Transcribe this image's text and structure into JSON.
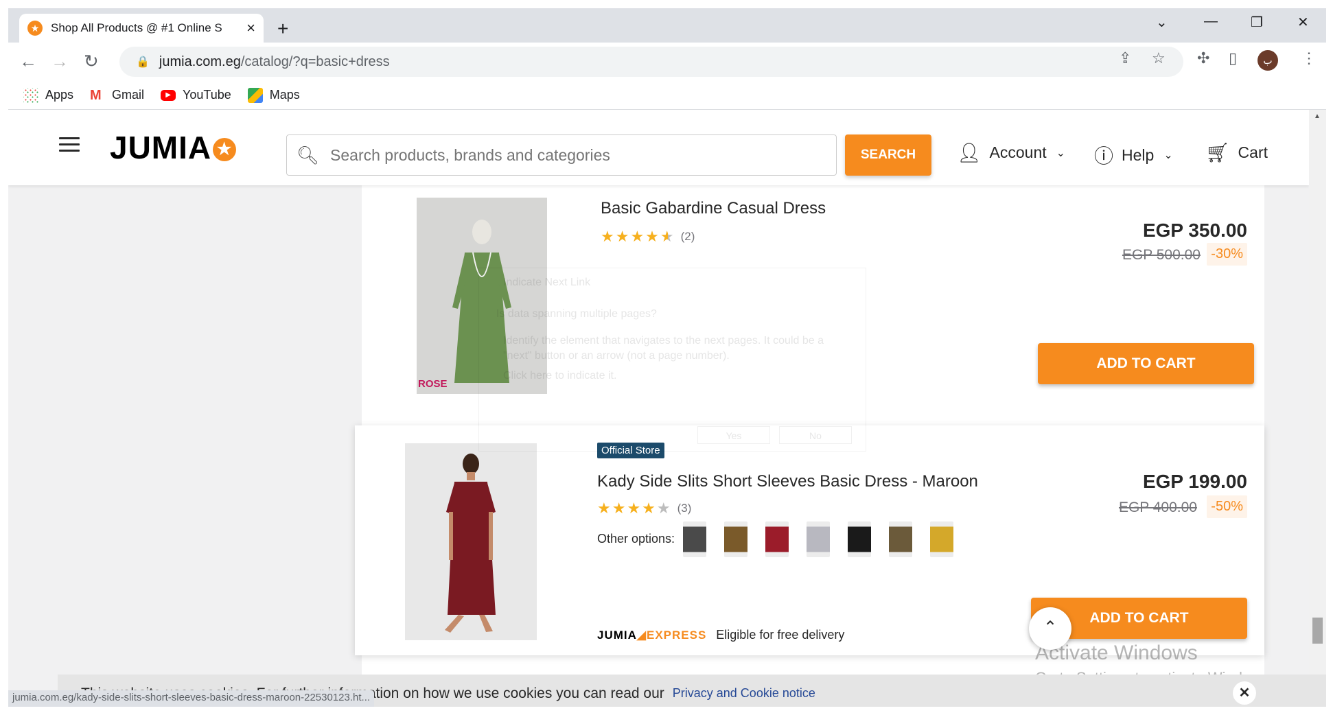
{
  "browser": {
    "tab_title": "Shop All Products @ #1 Online S",
    "url_host": "jumia.com.eg",
    "url_path": "/catalog/?q=basic+dress",
    "bookmarks": [
      "Apps",
      "Gmail",
      "YouTube",
      "Maps"
    ],
    "avatar_letter": "ب"
  },
  "header": {
    "logo": "JUMIA",
    "search_placeholder": "Search products, brands and categories",
    "search_button": "SEARCH",
    "account": "Account",
    "help": "Help",
    "cart": "Cart"
  },
  "products": [
    {
      "name": "Basic Gabardine Casual Dress",
      "rating_count": "(2)",
      "rating": 4.5,
      "price": "EGP 350.00",
      "old_price": "EGP 500.00",
      "discount": "-30%",
      "button": "ADD TO CART",
      "image_tag": "ROSE"
    },
    {
      "badge": "Official Store",
      "name": "Kady Side Slits Short Sleeves Basic Dress - Maroon",
      "rating_count": "(3)",
      "rating": 4,
      "price": "EGP 199.00",
      "old_price": "EGP 400.00",
      "discount": "-50%",
      "options_label": "Other options:",
      "option_colors": [
        "#4a4a4a",
        "#7a5a2a",
        "#9b1c2a",
        "#b8b8c0",
        "#1a1a1a",
        "#6b5a3a",
        "#d4a82a"
      ],
      "express_logo": "JUMIA",
      "express_word": "EXPRESS",
      "express_text": "Eligible for free delivery",
      "button": "ADD TO CART"
    }
  ],
  "ghost_dialog": {
    "title": "Indicate Next Link",
    "question": "Is data spanning multiple pages?",
    "body": "Identify the element that navigates to the next pages. It could be a \"next\" button or an arrow (not a page number).",
    "hint": "Click here to indicate it.",
    "yes": "Yes",
    "no": "No"
  },
  "watermark": {
    "title": "Activate Windows",
    "subtitle": "Go to Settings to activate Windows."
  },
  "cookie": {
    "text": "This website uses cookies. For further information on how we use cookies you can read our",
    "link": "Privacy and Cookie notice"
  },
  "status_url": "jumia.com.eg/kady-side-slits-short-sleeves-basic-dress-maroon-22530123.ht..."
}
